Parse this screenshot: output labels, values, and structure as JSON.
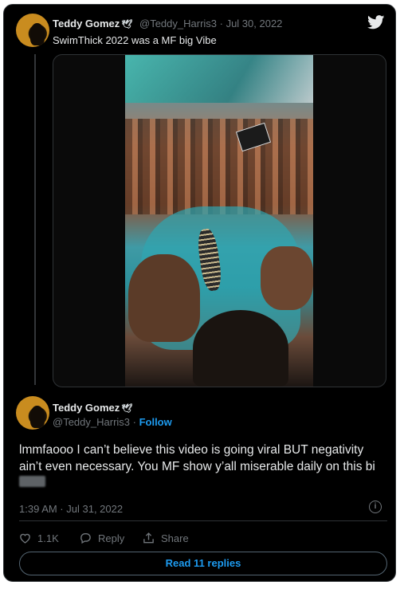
{
  "tweet1": {
    "name": "Teddy Gomez",
    "name_badge": "🕊",
    "handle_date": "@Teddy_Harris3 · Jul 30, 2022",
    "text": "SwimThick 2022 was a MF big Vibe"
  },
  "tweet2": {
    "name": "Teddy Gomez",
    "name_badge": "🕊",
    "handle": "@Teddy_Harris3 · ",
    "follow_label": "Follow",
    "text": "lmmfaooo I can’t believe this video is going viral BUT negativity ain’t even necessary. You MF show y’all miserable daily on this bi",
    "timestamp": "1:39 AM · Jul 31, 2022",
    "info_label": "i"
  },
  "actions": {
    "likes": "1.1K",
    "reply_label": "Reply",
    "share_label": "Share"
  },
  "read_replies": "Read 11 replies",
  "colors": {
    "background": "#000000",
    "accent": "#1d9bf0",
    "muted": "#71767b",
    "text": "#e7e9ea"
  },
  "icons": [
    "twitter-bird-icon",
    "heart-icon",
    "reply-bubble-icon",
    "share-icon",
    "info-icon",
    "dove-icon"
  ]
}
